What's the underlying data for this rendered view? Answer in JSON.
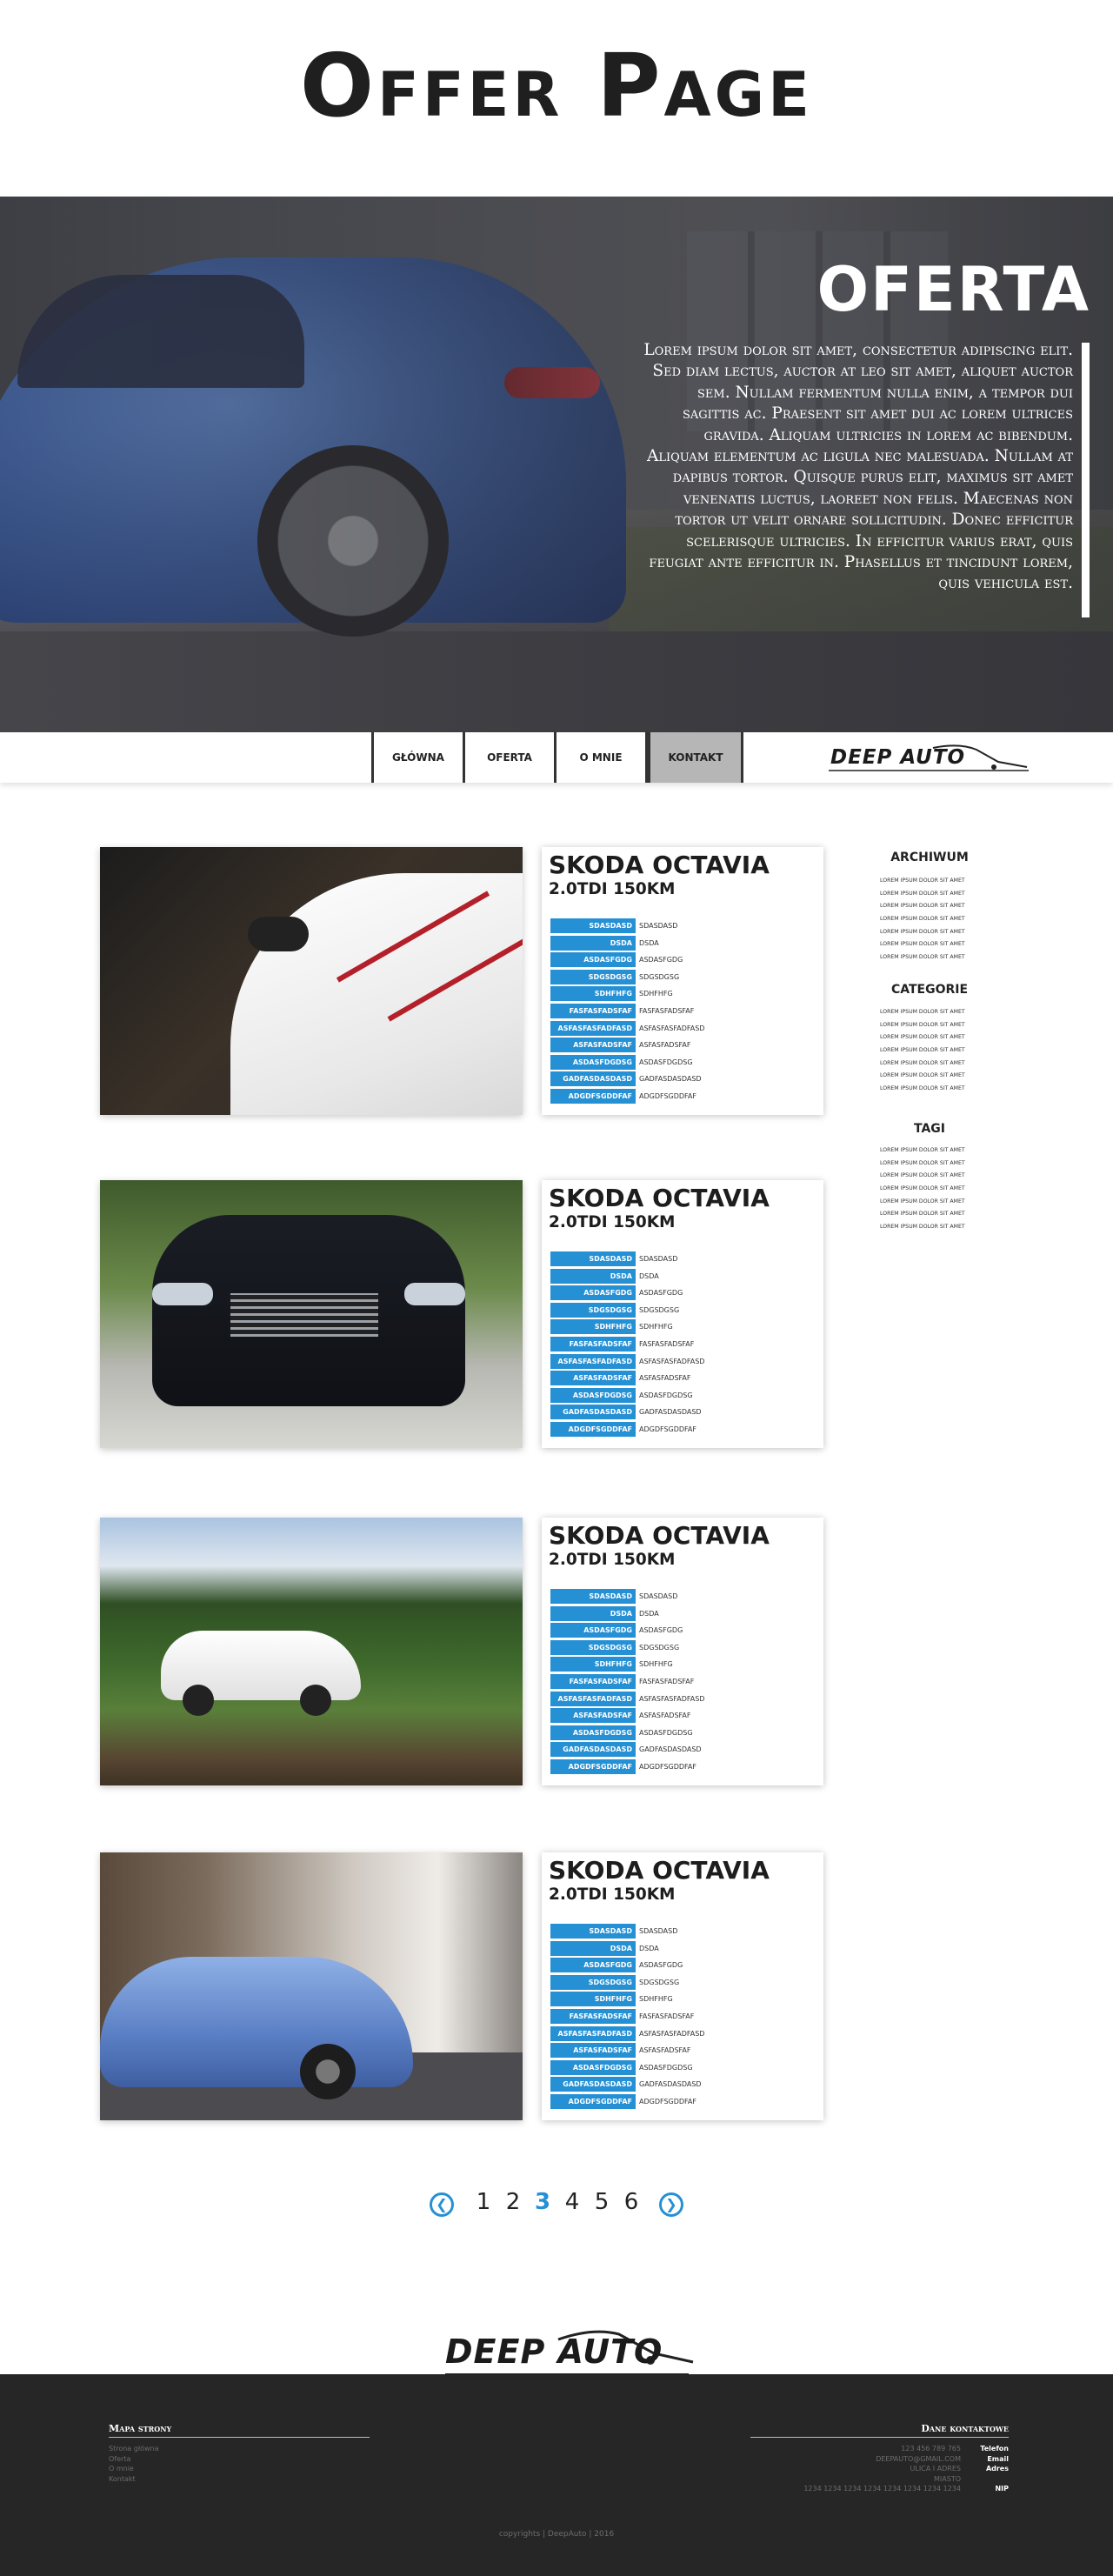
{
  "page": {
    "title": "Offer Page"
  },
  "hero": {
    "title": "OFERTA",
    "text": "Lorem ipsum dolor sit amet, consectetur adipiscing elit. Sed diam lectus, auctor at leo sit amet, aliquet auctor sem. Nullam fermentum nulla enim, a tempor dui sagittis ac. Praesent sit amet dui ac lorem ultrices gravida. Aliquam ultricies in lorem ac bibendum. Aliquam elementum ac ligula nec malesuada. Nullam at dapibus tortor. Quisque purus elit, maximus sit amet venenatis luctus, laoreet non felis. Maecenas non tortor ut velit ornare sollicitudin. Donec efficitur scelerisque ultricies. In efficitur varius erat, quis feugiat ante efficitur in. Phasellus et tincidunt lorem, quis vehicula est."
  },
  "nav": {
    "items": [
      {
        "label": "GŁÓWNA",
        "active": false
      },
      {
        "label": "OFERTA",
        "active": false
      },
      {
        "label": "O MNIE",
        "active": false
      },
      {
        "label": "KONTAKT",
        "active": true
      }
    ],
    "logo": "DEEP AUTO"
  },
  "offers": [
    {
      "title": "SKODA OCTAVIA",
      "subtitle": "2.0TDI 150KM",
      "image": "white-sports-car-photo",
      "specs": [
        [
          "SDASDASD",
          "SDASDASD"
        ],
        [
          "DSDA",
          "DSDA"
        ],
        [
          "ASDASFGDG",
          "ASDASFGDG"
        ],
        [
          "SDGSDGSG",
          "SDGSDGSG"
        ],
        [
          "SDHFHFG",
          "SDHFHFG"
        ],
        [
          "FASFASFADSFAF",
          "FASFASFADSFAF"
        ],
        [
          "ASFASFASFADFASD",
          "ASFASFASFADFASD"
        ],
        [
          "ASFASFADSFAF",
          "ASFASFADSFAF"
        ],
        [
          "ASDASFDGDSG",
          "ASDASFDGDSG"
        ],
        [
          "GADFASDASDASD",
          "GADFASDASDASD"
        ],
        [
          "ADGDFSGDDFAF",
          "ADGDFSGDDFAF"
        ]
      ]
    },
    {
      "title": "SKODA OCTAVIA",
      "subtitle": "2.0TDI 150KM",
      "image": "black-sedan-photo",
      "specs": [
        [
          "SDASDASD",
          "SDASDASD"
        ],
        [
          "DSDA",
          "DSDA"
        ],
        [
          "ASDASFGDG",
          "ASDASFGDG"
        ],
        [
          "SDGSDGSG",
          "SDGSDGSG"
        ],
        [
          "SDHFHFG",
          "SDHFHFG"
        ],
        [
          "FASFASFADSFAF",
          "FASFASFADSFAF"
        ],
        [
          "ASFASFASFADFASD",
          "ASFASFASFADFASD"
        ],
        [
          "ASFASFADSFAF",
          "ASFASFADSFAF"
        ],
        [
          "ASDASFDGDSG",
          "ASDASFDGDSG"
        ],
        [
          "GADFASDASDASD",
          "GADFASDASDASD"
        ],
        [
          "ADGDFSGDDFAF",
          "ADGDFSGDDFAF"
        ]
      ]
    },
    {
      "title": "SKODA OCTAVIA",
      "subtitle": "2.0TDI 150KM",
      "image": "white-electric-car-on-grass-photo",
      "specs": [
        [
          "SDASDASD",
          "SDASDASD"
        ],
        [
          "DSDA",
          "DSDA"
        ],
        [
          "ASDASFGDG",
          "ASDASFGDG"
        ],
        [
          "SDGSDGSG",
          "SDGSDGSG"
        ],
        [
          "SDHFHFG",
          "SDHFHFG"
        ],
        [
          "FASFASFADSFAF",
          "FASFASFADSFAF"
        ],
        [
          "ASFASFASFADFASD",
          "ASFASFASFADFASD"
        ],
        [
          "ASFASFADSFAF",
          "ASFASFADSFAF"
        ],
        [
          "ASDASFDGDSG",
          "ASDASFDGDSG"
        ],
        [
          "GADFASDASDASD",
          "GADFASDASDASD"
        ],
        [
          "ADGDFSGDDFAF",
          "ADGDFSGDDFAF"
        ]
      ]
    },
    {
      "title": "SKODA OCTAVIA",
      "subtitle": "2.0TDI 150KM",
      "image": "blue-coupe-city-street-photo",
      "specs": [
        [
          "SDASDASD",
          "SDASDASD"
        ],
        [
          "DSDA",
          "DSDA"
        ],
        [
          "ASDASFGDG",
          "ASDASFGDG"
        ],
        [
          "SDGSDGSG",
          "SDGSDGSG"
        ],
        [
          "SDHFHFG",
          "SDHFHFG"
        ],
        [
          "FASFASFADSFAF",
          "FASFASFADSFAF"
        ],
        [
          "ASFASFASFADFASD",
          "ASFASFASFADFASD"
        ],
        [
          "ASFASFADSFAF",
          "ASFASFADSFAF"
        ],
        [
          "ASDASFDGDSG",
          "ASDASFDGDSG"
        ],
        [
          "GADFASDASDASD",
          "GADFASDASDASD"
        ],
        [
          "ADGDFSGDDFAF",
          "ADGDFSGDDFAF"
        ]
      ]
    }
  ],
  "sidebar": {
    "sections": [
      {
        "title": "ARCHIWUM",
        "items": [
          "LOREM IPSUM DOLOR SIT AMET",
          "LOREM IPSUM DOLOR SIT AMET",
          "LOREM IPSUM DOLOR SIT AMET",
          "LOREM IPSUM DOLOR SIT AMET",
          "LOREM IPSUM DOLOR SIT AMET",
          "LOREM IPSUM DOLOR SIT AMET",
          "LOREM IPSUM DOLOR SIT AMET"
        ]
      },
      {
        "title": "CATEGORIE",
        "items": [
          "LOREM IPSUM DOLOR SIT AMET",
          "LOREM IPSUM DOLOR SIT AMET",
          "LOREM IPSUM DOLOR SIT AMET",
          "LOREM IPSUM DOLOR SIT AMET",
          "LOREM IPSUM DOLOR SIT AMET",
          "LOREM IPSUM DOLOR SIT AMET",
          "LOREM IPSUM DOLOR SIT AMET"
        ]
      },
      {
        "title": "TAGI",
        "items": [
          "LOREM IPSUM DOLOR SIT AMET",
          "LOREM IPSUM DOLOR SIT AMET",
          "LOREM IPSUM DOLOR SIT AMET",
          "LOREM IPSUM DOLOR SIT AMET",
          "LOREM IPSUM DOLOR SIT AMET",
          "LOREM IPSUM DOLOR SIT AMET",
          "LOREM IPSUM DOLOR SIT AMET"
        ]
      }
    ]
  },
  "pagination": {
    "prev_icon": "chevron-left-icon",
    "next_icon": "chevron-right-icon",
    "prev_glyph": "❮",
    "next_glyph": "❯",
    "pages": [
      "1",
      "2",
      "3",
      "4",
      "5",
      "6"
    ],
    "current": "3"
  },
  "footer": {
    "logo": "DEEP AUTO",
    "sitemap_title": "Mapa strony",
    "sitemap_items": [
      "Strona główna",
      "Oferta",
      "O mnie",
      "Kontakt"
    ],
    "contact_title": "Dane kontaktowe",
    "contact_values": [
      "123 456 789 765",
      "DEEPAUTO@GMAIL.COM",
      "ULICA I ADRES",
      "MIASTO",
      "1234 1234 1234 1234 1234 1234 1234 1234"
    ],
    "contact_labels": [
      "Telefon",
      "Email",
      "Adres",
      "",
      "NIP"
    ],
    "copyright": "copyrights | DeepAuto | 2016"
  },
  "colors": {
    "accent": "#2590d4",
    "footer_bg": "#262626",
    "text_dark": "#1d1d1d",
    "nav_active": "#b6b6b6"
  }
}
